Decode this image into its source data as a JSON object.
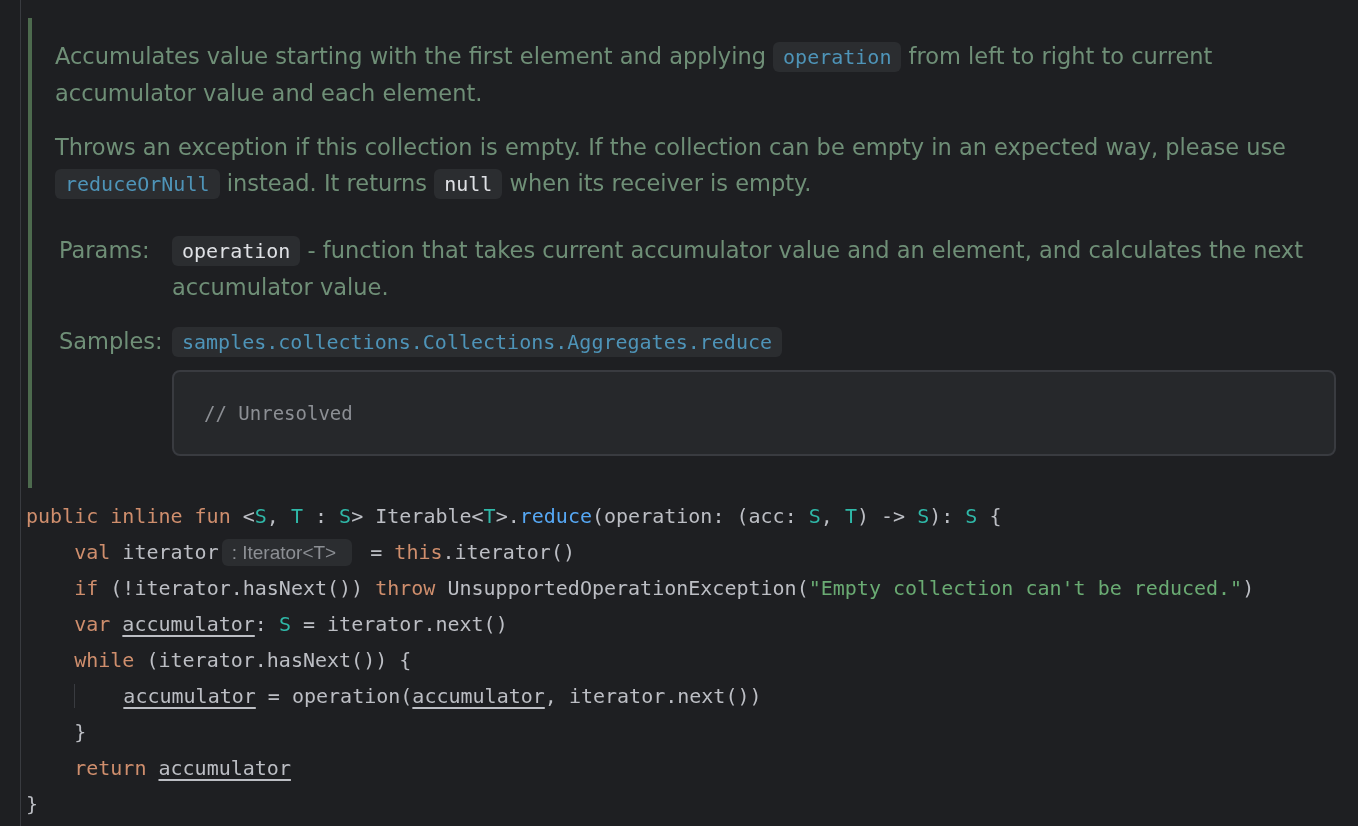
{
  "doc": {
    "paragraphs": [
      [
        {
          "kind": "text",
          "text": "Accumulates value starting with the first element and applying "
        },
        {
          "kind": "link",
          "text": "operation"
        },
        {
          "kind": "text",
          "text": " from left to right to current accumulator value and each element."
        }
      ],
      [
        {
          "kind": "text",
          "text": "Throws an exception if this collection is empty. If the collection can be empty in an expected way, please use "
        },
        {
          "kind": "link",
          "text": "reduceOrNull"
        },
        {
          "kind": "text",
          "text": " instead. It returns "
        },
        {
          "kind": "code",
          "text": "null"
        },
        {
          "kind": "text",
          "text": " when its receiver is empty."
        }
      ]
    ],
    "sections": [
      {
        "label": "Params:",
        "content": [
          {
            "kind": "code",
            "text": "operation"
          },
          {
            "kind": "text",
            "text": " - function that takes current accumulator value and an element, and calculates the next accumulator value."
          }
        ]
      },
      {
        "label": "Samples:",
        "content": [
          {
            "kind": "link",
            "text": "samples.collections.Collections.Aggregates.reduce"
          }
        ],
        "sample": "// Unresolved"
      }
    ]
  },
  "code": [
    {
      "tokens": [
        {
          "kind": "keyword",
          "text": "public inline fun "
        },
        {
          "kind": "plain",
          "text": "<"
        },
        {
          "kind": "type",
          "text": "S"
        },
        {
          "kind": "plain",
          "text": ", "
        },
        {
          "kind": "type",
          "text": "T"
        },
        {
          "kind": "plain",
          "text": " : "
        },
        {
          "kind": "type",
          "text": "S"
        },
        {
          "kind": "plain",
          "text": "> Iterable<"
        },
        {
          "kind": "type",
          "text": "T"
        },
        {
          "kind": "plain",
          "text": ">."
        },
        {
          "kind": "function",
          "text": "reduce"
        },
        {
          "kind": "plain",
          "text": "(operation: (acc: "
        },
        {
          "kind": "type",
          "text": "S"
        },
        {
          "kind": "plain",
          "text": ", "
        },
        {
          "kind": "type",
          "text": "T"
        },
        {
          "kind": "plain",
          "text": ") -> "
        },
        {
          "kind": "type",
          "text": "S"
        },
        {
          "kind": "plain",
          "text": "): "
        },
        {
          "kind": "type",
          "text": "S"
        },
        {
          "kind": "plain",
          "text": " {"
        }
      ]
    },
    {
      "tokens": [
        {
          "kind": "keyword",
          "text": "    val "
        },
        {
          "kind": "plain",
          "text": "iterator"
        },
        {
          "kind": "hint",
          "text": ": Iterator<T>"
        },
        {
          "kind": "plain",
          "text": " = "
        },
        {
          "kind": "keyword",
          "text": "this"
        },
        {
          "kind": "plain",
          "text": ".iterator()"
        }
      ]
    },
    {
      "tokens": [
        {
          "kind": "keyword",
          "text": "    if "
        },
        {
          "kind": "plain",
          "text": "(!iterator.hasNext()) "
        },
        {
          "kind": "keyword",
          "text": "throw "
        },
        {
          "kind": "plain",
          "text": "UnsupportedOperationException("
        },
        {
          "kind": "string",
          "text": "\"Empty collection can't be reduced.\""
        },
        {
          "kind": "plain",
          "text": ")"
        }
      ]
    },
    {
      "tokens": [
        {
          "kind": "keyword",
          "text": "    var "
        },
        {
          "kind": "variable",
          "text": "accumulator"
        },
        {
          "kind": "plain",
          "text": ": "
        },
        {
          "kind": "type",
          "text": "S"
        },
        {
          "kind": "plain",
          "text": " = iterator.next()"
        }
      ]
    },
    {
      "tokens": [
        {
          "kind": "keyword",
          "text": "    while "
        },
        {
          "kind": "plain",
          "text": "(iterator.hasNext()) {"
        }
      ]
    },
    {
      "indent_guide": true,
      "tokens": [
        {
          "kind": "variable",
          "text": "        accumulator"
        },
        {
          "kind": "plain",
          "text": " = operation("
        },
        {
          "kind": "variable",
          "text": "accumulator"
        },
        {
          "kind": "plain",
          "text": ", iterator.next())"
        }
      ]
    },
    {
      "tokens": [
        {
          "kind": "plain",
          "text": "    }"
        }
      ]
    },
    {
      "tokens": [
        {
          "kind": "keyword",
          "text": "    return "
        },
        {
          "kind": "variable",
          "text": "accumulator"
        }
      ]
    },
    {
      "tokens": [
        {
          "kind": "plain",
          "text": "}"
        }
      ]
    }
  ]
}
